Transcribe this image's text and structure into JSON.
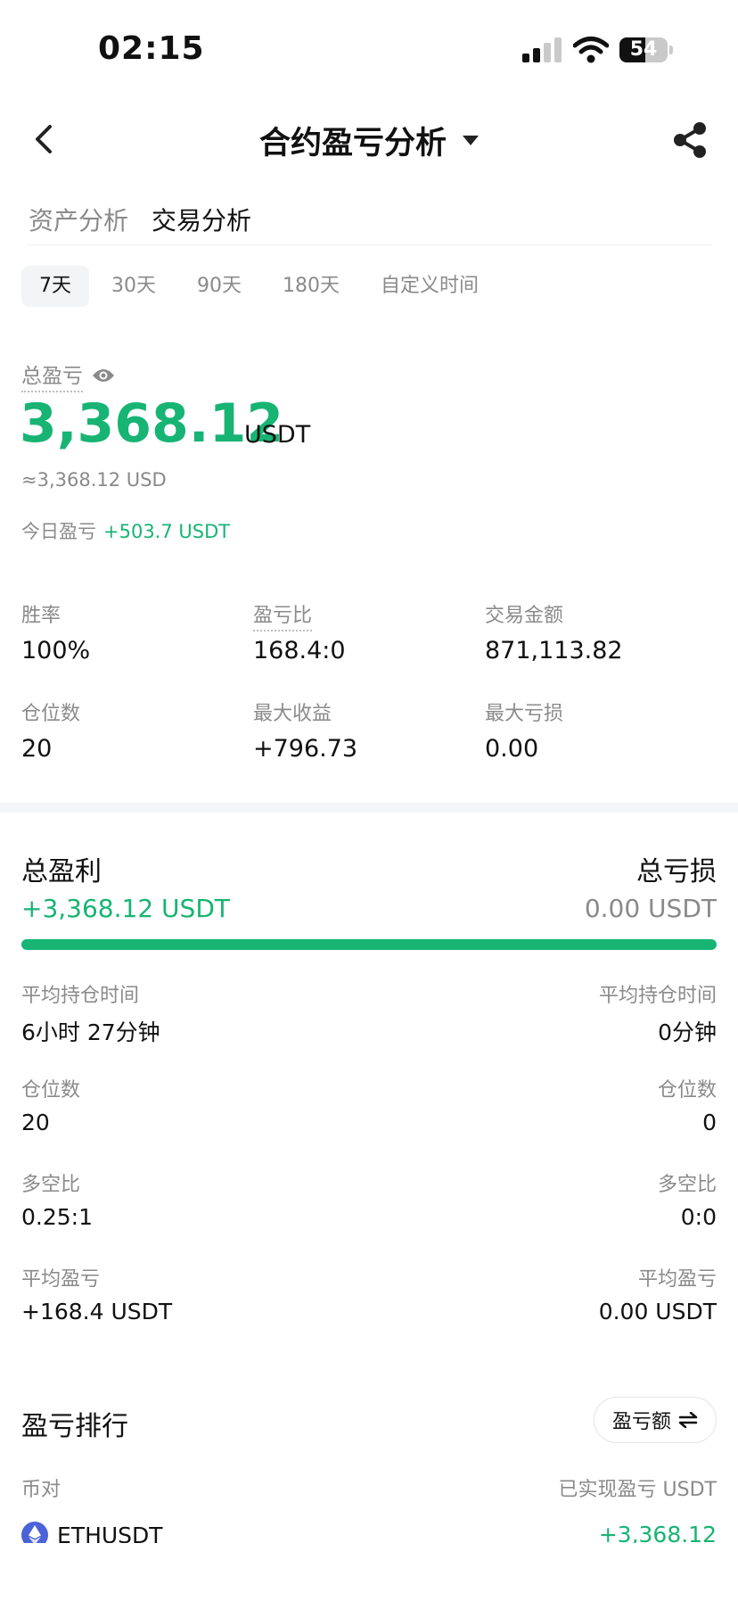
{
  "status_bar": {
    "time": "02:15",
    "battery": "54",
    "battery_level": 0.54
  },
  "header": {
    "title": "合约盈亏分析"
  },
  "tabs": [
    {
      "label": "资产分析"
    },
    {
      "label": "交易分析"
    }
  ],
  "time_filters": [
    {
      "label": "7天"
    },
    {
      "label": "30天"
    },
    {
      "label": "90天"
    },
    {
      "label": "180天"
    },
    {
      "label": "自定义时间"
    }
  ],
  "summary": {
    "total_pnl_label": "总盈亏",
    "total_pnl_value": "3,368.12",
    "total_pnl_unit": "USDT",
    "usd_approx": "≈3,368.12 USD",
    "today_label": "今日盈亏",
    "today_value": "+503.7 USDT"
  },
  "stats": {
    "win_rate": {
      "label": "胜率",
      "value": "100%"
    },
    "pnl_ratio": {
      "label": "盈亏比",
      "value": "168.4:0"
    },
    "trade_amount": {
      "label": "交易金额",
      "value": "871,113.82"
    },
    "positions": {
      "label": "仓位数",
      "value": "20"
    },
    "max_profit": {
      "label": "最大收益",
      "value": "+796.73"
    },
    "max_loss": {
      "label": "最大亏损",
      "value": "0.00"
    }
  },
  "profit_loss": {
    "profit_title": "总盈利",
    "loss_title": "总亏损",
    "profit_value": "+3,368.12 USDT",
    "loss_value": "0.00 USDT",
    "profit_share": 1.0,
    "rows": [
      {
        "label": "平均持仓时间",
        "profit": "6小时 27分钟",
        "loss": "0分钟"
      },
      {
        "label": "仓位数",
        "profit": "20",
        "loss": "0"
      },
      {
        "label": "多空比",
        "profit": "0.25:1",
        "loss": "0:0"
      },
      {
        "label": "平均盈亏",
        "profit": "+168.4 USDT",
        "loss": "0.00 USDT"
      }
    ]
  },
  "ranking": {
    "title": "盈亏排行",
    "sort_button": "盈亏额",
    "col_pair": "币对",
    "col_pnl": "已实现盈亏 USDT",
    "items": [
      {
        "pair": "ETHUSDT",
        "pnl": "+3,368.12"
      }
    ]
  },
  "colors": {
    "positive": "#17b474",
    "negative": "#e8265e",
    "muted": "#8a8a8a"
  }
}
